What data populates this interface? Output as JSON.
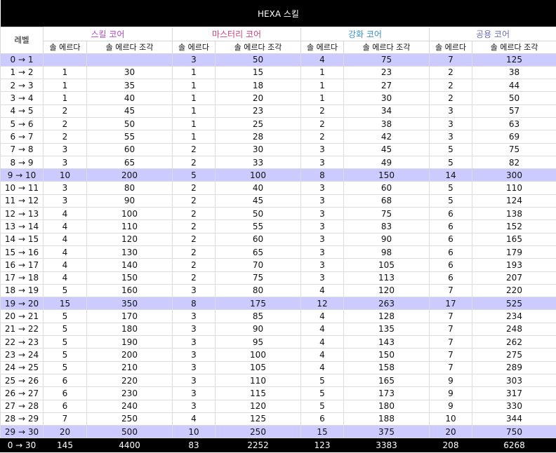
{
  "title": "HEXA 스킬",
  "level_header": "레벨",
  "groups": [
    {
      "label": "스킬 코어",
      "color": "#b04ac4"
    },
    {
      "label": "마스터리 코어",
      "color": "#d0407a"
    },
    {
      "label": "강화 코어",
      "color": "#3a8fd0"
    },
    {
      "label": "공용 코어",
      "color": "#6a6fb8"
    }
  ],
  "sub_headers": [
    "솔 에르다",
    "솔 에르다 조각"
  ],
  "highlight_color": "#cccbff",
  "rows": [
    {
      "level": "0 → 1",
      "hl": true,
      "v": [
        "",
        "",
        "3",
        "50",
        "4",
        "75",
        "7",
        "125"
      ]
    },
    {
      "level": "1 → 2",
      "v": [
        "1",
        "30",
        "1",
        "15",
        "1",
        "23",
        "2",
        "38"
      ]
    },
    {
      "level": "2 → 3",
      "v": [
        "1",
        "35",
        "1",
        "18",
        "1",
        "27",
        "2",
        "44"
      ]
    },
    {
      "level": "3 → 4",
      "v": [
        "1",
        "40",
        "1",
        "20",
        "1",
        "30",
        "2",
        "50"
      ]
    },
    {
      "level": "4 → 5",
      "v": [
        "2",
        "45",
        "1",
        "23",
        "2",
        "34",
        "3",
        "57"
      ]
    },
    {
      "level": "5 → 6",
      "v": [
        "2",
        "50",
        "1",
        "25",
        "2",
        "38",
        "3",
        "63"
      ]
    },
    {
      "level": "6 → 7",
      "v": [
        "2",
        "55",
        "1",
        "28",
        "2",
        "42",
        "3",
        "69"
      ]
    },
    {
      "level": "7 → 8",
      "v": [
        "3",
        "60",
        "2",
        "30",
        "3",
        "45",
        "5",
        "75"
      ]
    },
    {
      "level": "8 → 9",
      "v": [
        "3",
        "65",
        "2",
        "33",
        "3",
        "49",
        "5",
        "82"
      ]
    },
    {
      "level": "9 → 10",
      "hl": true,
      "v": [
        "10",
        "200",
        "5",
        "100",
        "8",
        "150",
        "14",
        "300"
      ]
    },
    {
      "level": "10 → 11",
      "v": [
        "3",
        "80",
        "2",
        "40",
        "3",
        "60",
        "5",
        "110"
      ]
    },
    {
      "level": "11 → 12",
      "v": [
        "3",
        "90",
        "2",
        "45",
        "3",
        "68",
        "5",
        "124"
      ]
    },
    {
      "level": "12 → 13",
      "v": [
        "4",
        "100",
        "2",
        "50",
        "3",
        "75",
        "6",
        "138"
      ]
    },
    {
      "level": "13 → 14",
      "v": [
        "4",
        "110",
        "2",
        "55",
        "3",
        "83",
        "6",
        "152"
      ]
    },
    {
      "level": "14 → 15",
      "v": [
        "4",
        "120",
        "2",
        "60",
        "3",
        "90",
        "6",
        "165"
      ]
    },
    {
      "level": "15 → 16",
      "v": [
        "4",
        "130",
        "2",
        "65",
        "3",
        "98",
        "6",
        "179"
      ]
    },
    {
      "level": "16 → 17",
      "v": [
        "4",
        "140",
        "2",
        "70",
        "3",
        "105",
        "6",
        "193"
      ]
    },
    {
      "level": "17 → 18",
      "v": [
        "4",
        "150",
        "2",
        "75",
        "3",
        "113",
        "6",
        "207"
      ]
    },
    {
      "level": "18 → 19",
      "v": [
        "5",
        "160",
        "3",
        "80",
        "4",
        "120",
        "7",
        "220"
      ]
    },
    {
      "level": "19 → 20",
      "hl": true,
      "v": [
        "15",
        "350",
        "8",
        "175",
        "12",
        "263",
        "17",
        "525"
      ]
    },
    {
      "level": "20 → 21",
      "v": [
        "5",
        "170",
        "3",
        "85",
        "4",
        "128",
        "7",
        "234"
      ]
    },
    {
      "level": "21 → 22",
      "v": [
        "5",
        "180",
        "3",
        "90",
        "4",
        "135",
        "7",
        "248"
      ]
    },
    {
      "level": "22 → 23",
      "v": [
        "5",
        "190",
        "3",
        "95",
        "4",
        "143",
        "7",
        "262"
      ]
    },
    {
      "level": "23 → 24",
      "v": [
        "5",
        "200",
        "3",
        "100",
        "4",
        "150",
        "7",
        "275"
      ]
    },
    {
      "level": "24 → 25",
      "v": [
        "5",
        "210",
        "3",
        "105",
        "4",
        "158",
        "7",
        "289"
      ]
    },
    {
      "level": "25 → 26",
      "v": [
        "6",
        "220",
        "3",
        "110",
        "5",
        "165",
        "9",
        "303"
      ]
    },
    {
      "level": "26 → 27",
      "v": [
        "6",
        "230",
        "3",
        "115",
        "5",
        "173",
        "9",
        "317"
      ]
    },
    {
      "level": "27 → 28",
      "v": [
        "6",
        "240",
        "3",
        "120",
        "5",
        "180",
        "9",
        "330"
      ]
    },
    {
      "level": "28 → 29",
      "v": [
        "7",
        "250",
        "4",
        "125",
        "6",
        "188",
        "10",
        "344"
      ]
    },
    {
      "level": "29 → 30",
      "hl": true,
      "v": [
        "20",
        "500",
        "10",
        "250",
        "15",
        "375",
        "20",
        "750"
      ]
    }
  ],
  "total": {
    "level": "0 → 30",
    "v": [
      "145",
      "4400",
      "83",
      "2252",
      "123",
      "3383",
      "208",
      "6268"
    ]
  }
}
